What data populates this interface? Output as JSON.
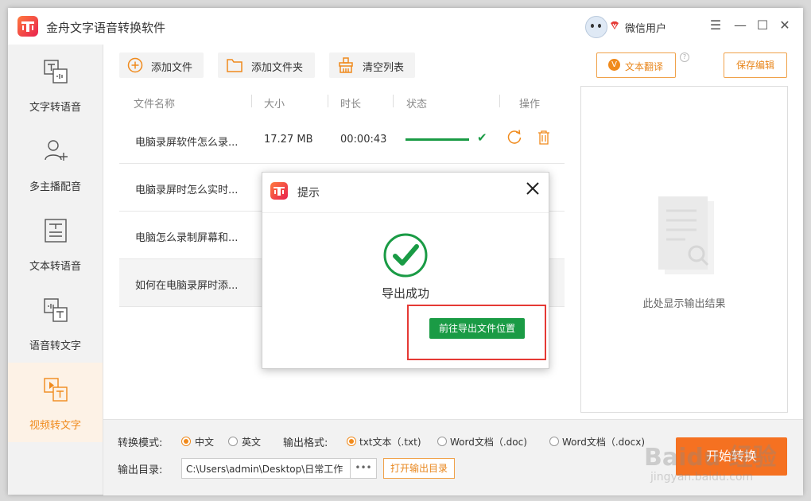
{
  "app": {
    "title": "金舟文字语音转换软件",
    "username": "微信用户"
  },
  "window_controls": {
    "menu": "☰",
    "minimize": "—",
    "maximize": "☐",
    "close": "✕"
  },
  "sidebar": {
    "items": [
      {
        "label": "文字转语音",
        "icon": "text-to-speech-icon"
      },
      {
        "label": "多主播配音",
        "icon": "multi-voice-icon"
      },
      {
        "label": "文本转语音",
        "icon": "document-to-speech-icon"
      },
      {
        "label": "语音转文字",
        "icon": "speech-to-text-icon"
      },
      {
        "label": "视频转文字",
        "icon": "video-to-text-icon",
        "active": true
      }
    ]
  },
  "toolbar": {
    "add_file": "添加文件",
    "add_folder": "添加文件夹",
    "clear_list": "清空列表"
  },
  "table": {
    "headers": [
      "文件名称",
      "大小",
      "时长",
      "状态",
      "操作"
    ],
    "rows": [
      {
        "name": "电脑录屏软件怎么录...",
        "size": "17.27 MB",
        "duration": "00:00:43",
        "progress": 1.0
      },
      {
        "name": "电脑录屏时怎么实时..."
      },
      {
        "name": "电脑怎么录制屏幕和..."
      },
      {
        "name": "如何在电脑录屏时添..."
      }
    ]
  },
  "right_panel": {
    "translate_btn": "文本翻译",
    "save_btn": "保存编辑",
    "placeholder": "此处显示输出结果"
  },
  "bottom": {
    "mode_label": "转换模式:",
    "mode_options": [
      "中文",
      "英文"
    ],
    "mode_selected": "中文",
    "format_label": "输出格式:",
    "format_options": [
      "txt文本（.txt)",
      "Word文档（.doc)",
      "Word文档（.docx)"
    ],
    "format_selected": "txt文本（.txt)",
    "dir_label": "输出目录:",
    "dir_value": "C:\\Users\\admin\\Desktop\\日常工作",
    "dir_browse": "•••",
    "open_dir_btn": "打开输出目录",
    "start_btn": "开始转换"
  },
  "dialog": {
    "title": "提示",
    "message": "导出成功",
    "button": "前往导出文件位置"
  },
  "watermark": {
    "brand": "Baidu 经验",
    "url": "jingyan.baidu.com"
  },
  "colors": {
    "accent": "#f08a1c",
    "success": "#1a9b45",
    "start": "#f57121",
    "highlight": "#e53935"
  }
}
